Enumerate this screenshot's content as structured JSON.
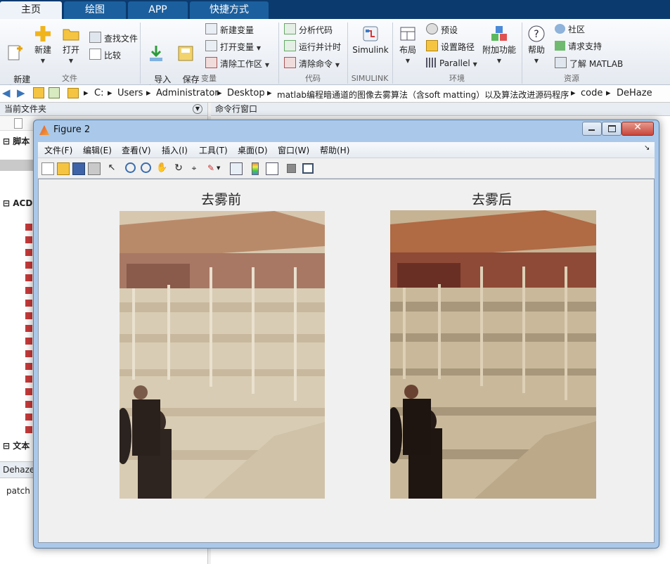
{
  "tabs": [
    "主页",
    "绘图",
    "APP",
    "快捷方式"
  ],
  "ribbon": {
    "file": {
      "new_script": "新建\n脚本",
      "new": "新建",
      "open": "打开",
      "find_files": "查找文件",
      "compare": "比较",
      "group": "文件"
    },
    "variable": {
      "import": "导入\n数据",
      "save_ws": "保存\n工作区",
      "new_var": "新建变量",
      "open_var": "打开变量",
      "clear_ws": "清除工作区",
      "group": "变量"
    },
    "code": {
      "analyze": "分析代码",
      "run_time": "运行并计时",
      "clear_cmd": "清除命令",
      "group": "代码"
    },
    "simulink": {
      "label": "Simulink",
      "group": "SIMULINK"
    },
    "env": {
      "layout": "布局",
      "prefs": "预设",
      "set_path": "设置路径",
      "parallel": "Parallel",
      "addons": "附加功能",
      "group": "环境"
    },
    "resources": {
      "help": "帮助",
      "community": "社区",
      "support": "请求支持",
      "learn": "了解 MATLAB",
      "group": "资源"
    }
  },
  "address": {
    "parts": [
      "C:",
      "Users",
      "Administrator",
      "Desktop",
      "matlab编程暗通道的图像去雾算法（含soft matting）以及算法改进源码程序",
      "code",
      "DeHaze"
    ]
  },
  "left_panel": {
    "title": "当前文件夹",
    "section1": "脚本",
    "section2": "ACDS",
    "section3": "文本",
    "bottom_tab": "Dehaze",
    "bottom_text": "patch s"
  },
  "command_window": {
    "title": "命令行窗口"
  },
  "figure": {
    "title": "Figure 2",
    "menus": [
      "文件(F)",
      "编辑(E)",
      "查看(V)",
      "插入(I)",
      "工具(T)",
      "桌面(D)",
      "窗口(W)",
      "帮助(H)"
    ],
    "axes": [
      {
        "title": "去雾前"
      },
      {
        "title": "去雾后"
      }
    ]
  },
  "colors": {
    "tab_strip": "#0b3a6e",
    "tab": "#1b5f9e",
    "figure_frame": "#aac9ea",
    "close_button": "#c9463d"
  }
}
